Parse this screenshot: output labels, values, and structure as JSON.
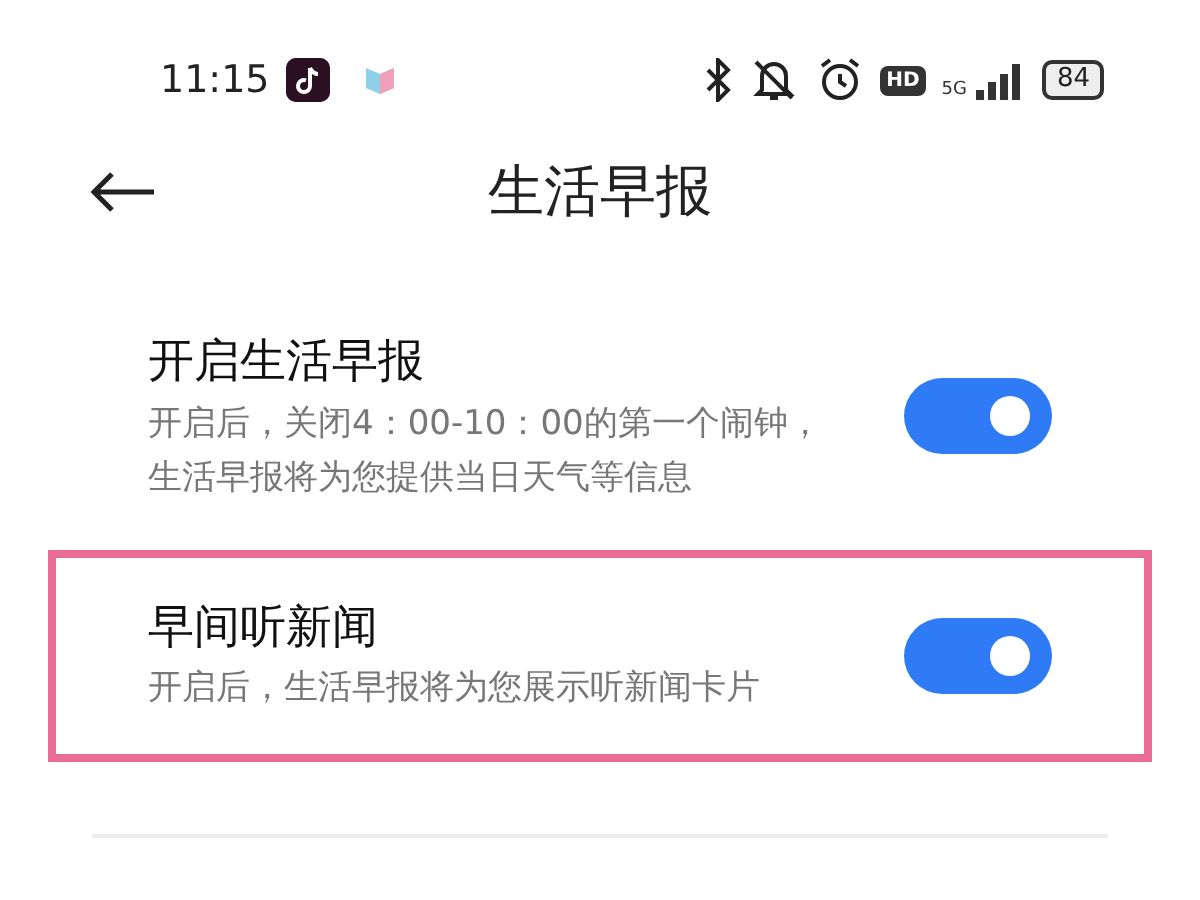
{
  "status_bar": {
    "time": "11:15",
    "hd_label": "HD",
    "network_label": "5G",
    "battery": "84"
  },
  "header": {
    "title": "生活早报"
  },
  "settings": [
    {
      "title": "开启生活早报",
      "description": "开启后，关闭4：00-10：00的第一个闹钟，生活早报将为您提供当日天气等信息",
      "on": true,
      "highlighted": false
    },
    {
      "title": "早间听新闻",
      "description": "开启后，生活早报将为您展示听新闻卡片",
      "on": true,
      "highlighted": true
    }
  ]
}
